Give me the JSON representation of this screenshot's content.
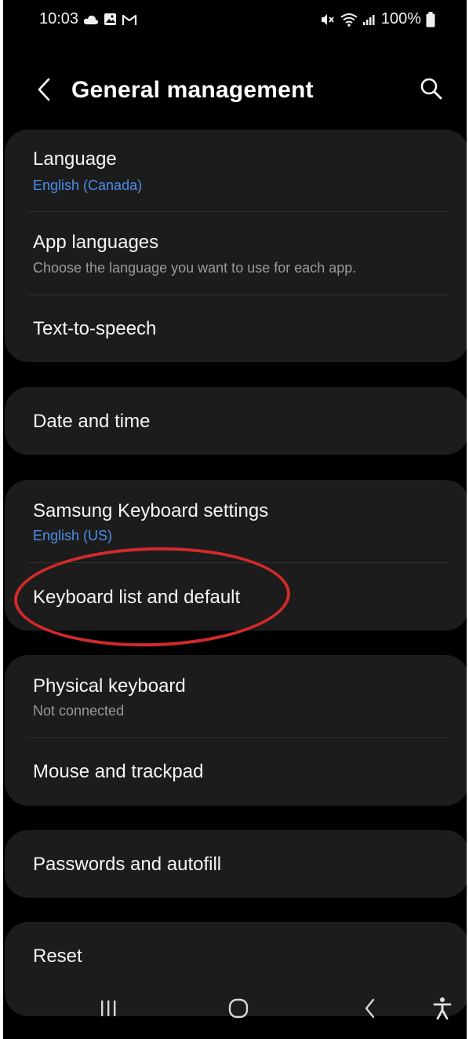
{
  "status_bar": {
    "time": "10:03",
    "battery": "100%",
    "left_icons": [
      "cloud-icon",
      "image-icon",
      "gmail-icon"
    ],
    "right_icons": [
      "mute-icon",
      "wifi-icon",
      "signal-icon",
      "battery-icon"
    ]
  },
  "header": {
    "title": "General management",
    "back_icon": "chevron-left-icon",
    "search_icon": "search-icon"
  },
  "groups": [
    {
      "items": [
        {
          "title": "Language",
          "subtitle": "English (Canada)",
          "subtitle_color": "#4a8fe8"
        },
        {
          "title": "App languages",
          "subtitle": "Choose the language you want to use for each app.",
          "subtitle_color": "#9a9a9a"
        },
        {
          "title": "Text-to-speech"
        }
      ]
    },
    {
      "items": [
        {
          "title": "Date and time"
        }
      ]
    },
    {
      "items": [
        {
          "title": "Samsung Keyboard settings",
          "subtitle": "English (US)",
          "subtitle_color": "#4a8fe8"
        },
        {
          "title": "Keyboard list and default"
        }
      ]
    },
    {
      "items": [
        {
          "title": "Physical keyboard",
          "subtitle": "Not connected",
          "subtitle_color": "#9a9a9a"
        },
        {
          "title": "Mouse and trackpad"
        }
      ]
    },
    {
      "items": [
        {
          "title": "Passwords and autofill"
        }
      ]
    },
    {
      "items": [
        {
          "title": "Reset"
        }
      ]
    }
  ],
  "annotation": {
    "highlighted_item": "Keyboard list and default",
    "color": "#d22a2a"
  },
  "nav_bar": {
    "icons": [
      "recents-icon",
      "home-icon",
      "back-icon",
      "accessibility-icon"
    ]
  },
  "colors": {
    "background": "#000000",
    "card": "#1c1c1c",
    "accent_blue": "#4a8fe8",
    "text_primary": "#f5f5f5",
    "text_secondary": "#9a9a9a"
  }
}
